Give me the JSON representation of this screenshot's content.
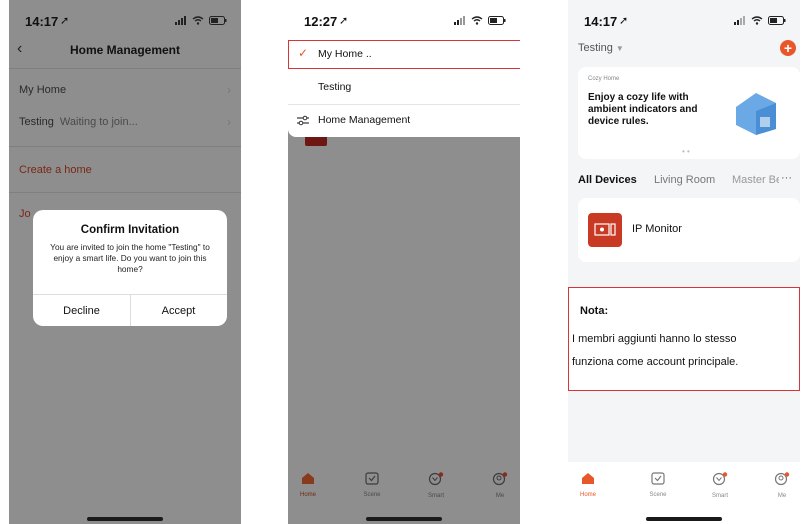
{
  "screen1": {
    "time": "14:17",
    "title": "Home Management",
    "items": [
      {
        "name": "My Home",
        "status": ""
      },
      {
        "name": "Testing",
        "status": "Waiting to join..."
      }
    ],
    "create_label": "Create a home",
    "join_label": "Jo",
    "dialog": {
      "title": "Confirm Invitation",
      "message": "You are invited to join the home \"Testing\" to enjoy a smart life. Do you want to join this home?",
      "decline": "Decline",
      "accept": "Accept"
    }
  },
  "screen2": {
    "time": "12:27",
    "menu": [
      {
        "label": "My Home ..",
        "selected": true
      },
      {
        "label": "Testing",
        "selected": false
      },
      {
        "label": "Home Management",
        "selected": false
      }
    ],
    "tabs": [
      {
        "label": "Home",
        "icon": "home-icon",
        "active": true
      },
      {
        "label": "Scene",
        "icon": "scene-icon",
        "active": false
      },
      {
        "label": "Smart",
        "icon": "smart-icon",
        "active": false
      },
      {
        "label": "Me",
        "icon": "me-icon",
        "active": false
      }
    ]
  },
  "screen3": {
    "time": "14:17",
    "home_selector": "Testing",
    "banner": {
      "tag": "Cozy Home",
      "text": "Enjoy a cozy life with ambient indicators and device rules."
    },
    "rooms": [
      "All Devices",
      "Living Room",
      "Master Be"
    ],
    "device": "IP Monitor",
    "note_title": "Nota:",
    "note_lines": [
      "I membri aggiunti hanno lo stesso",
      "funziona come account principale."
    ],
    "tabs": [
      {
        "label": "Home",
        "icon": "home-icon",
        "active": true
      },
      {
        "label": "Scene",
        "icon": "scene-icon",
        "active": false
      },
      {
        "label": "Smart",
        "icon": "smart-icon",
        "active": false
      },
      {
        "label": "Me",
        "icon": "me-icon",
        "active": false
      }
    ]
  },
  "colors": {
    "accent": "#e8572a",
    "highlight": "#d8353a",
    "dim_bg": "#8e8e8e"
  }
}
